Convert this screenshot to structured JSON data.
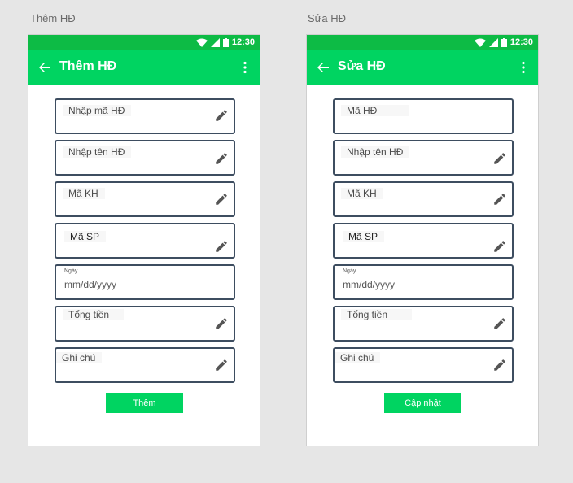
{
  "screens": [
    {
      "artboard_label": "Thêm HĐ",
      "title": "Thêm HĐ",
      "time": "12:30",
      "fields": [
        {
          "label": "Nhập mã HĐ",
          "has_pen": true
        },
        {
          "label": "Nhập tên HĐ",
          "has_pen": true
        },
        {
          "label": "Mã KH",
          "has_pen": true
        },
        {
          "label": "Mã SP",
          "has_pen": true
        },
        {
          "label": "Ngày",
          "value": "mm/dd/yyyy",
          "has_pen": false
        },
        {
          "label": "Tổng tiền",
          "has_pen": true
        },
        {
          "label": "Ghi chú",
          "has_pen": true
        }
      ],
      "button_label": "Thêm"
    },
    {
      "artboard_label": "Sửa HĐ",
      "title": "Sửa HĐ",
      "time": "12:30",
      "fields": [
        {
          "label": "Mã HĐ",
          "has_pen": false
        },
        {
          "label": "Nhập tên HĐ",
          "has_pen": true
        },
        {
          "label": "Mã KH",
          "has_pen": true
        },
        {
          "label": "Mã SP",
          "has_pen": true
        },
        {
          "label": "Ngày",
          "value": "mm/dd/yyyy",
          "has_pen": false
        },
        {
          "label": "Tổng tiền",
          "has_pen": true
        },
        {
          "label": "Ghi chú",
          "has_pen": true
        }
      ],
      "button_label": "Cập nhật"
    }
  ],
  "icons": {
    "status": [
      "wifi-icon",
      "signal-icon",
      "battery-icon"
    ],
    "toolbar": [
      "back-arrow-icon",
      "more-vert-icon"
    ],
    "field": "edit-pencil-icon"
  },
  "colors": {
    "status_bar": "#0dbb45",
    "toolbar": "#00d461",
    "button": "#00d461",
    "field_border": "#3d4d60"
  }
}
